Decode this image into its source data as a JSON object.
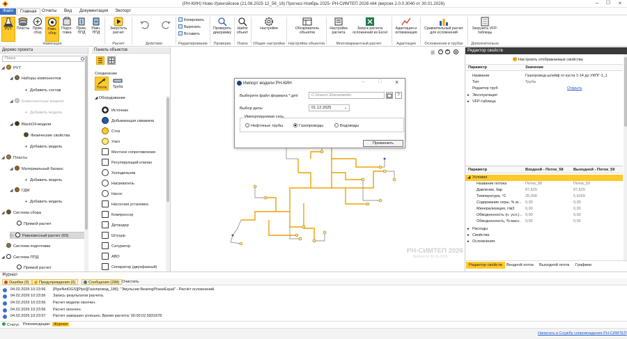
{
  "window": {
    "title": "(РН-КИН) Ново-Уренгойское (21.08.2025 12_56_16) Прогноз Ноябрь 2025-     РН-СИМТЕП 2026 x64 (версия 2.0.0.3040 от 30.01.2026)"
  },
  "menu": {
    "items": [
      "Файл",
      "Главная",
      "Отчеты",
      "Вид",
      "Документация",
      "Экспорт"
    ]
  },
  "ribbon": {
    "buttons": [
      {
        "label": "PVT"
      },
      {
        "label": "Пласты"
      },
      {
        "label": "Прям. сбор"
      },
      {
        "label": "Равн. сбор"
      },
      {
        "label": "Подго- товка"
      },
      {
        "label": "Прям. ППД"
      },
      {
        "label": "Равн. ППД"
      },
      {
        "label": "Запустить расчет"
      },
      {
        "label": "Проверить диаграмму"
      },
      {
        "label": "Найти объект"
      },
      {
        "label": "Настройки"
      },
      {
        "label": "Обозреватель объектов"
      },
      {
        "label": "Настройка расчета"
      },
      {
        "label": "Запуск расчета осложнений из Excel"
      },
      {
        "label": "Адаптация и оптимизация"
      },
      {
        "label": "Сравнительный расчет для осложнений"
      },
      {
        "label": "Загрузить VFP-таблицы"
      }
    ],
    "small": [
      "Копировать",
      "Вырезать",
      "Вставить"
    ],
    "groups": [
      "Навигация",
      "Расчет",
      "Действия",
      "Редактирование",
      "Проверка",
      "Поиск",
      "Общие настройки",
      "Настройка объектов",
      "Многовариантный расчет",
      "Адаптация",
      "Осложнения в трубах",
      "Дополнительно"
    ]
  },
  "tree": {
    "header": "Дерево проекта",
    "search_placeholder": "Поиск",
    "items": [
      {
        "label": "PVT"
      },
      {
        "label": "Наборы компонентов"
      },
      {
        "label": "Добавить состав"
      },
      {
        "label": "Компонентные модели"
      },
      {
        "label": "Добавить модель"
      },
      {
        "label": "BlackOil-модели"
      },
      {
        "label": "Физические свойства"
      },
      {
        "label": "Добавить модель"
      },
      {
        "label": "Пласты"
      },
      {
        "label": "Материальный баланс"
      },
      {
        "label": "Добавить модель"
      },
      {
        "label": "ГДМ"
      },
      {
        "label": "Добавить модель"
      },
      {
        "label": "Система сбора"
      },
      {
        "label": "Прямой расчет"
      },
      {
        "label": "Равновесный расчет (69)"
      },
      {
        "label": "Система подготовки"
      },
      {
        "label": "Система ППД"
      },
      {
        "label": "Прямой расчет"
      }
    ]
  },
  "objects": {
    "header": "Панель объектов",
    "connection_label": "Соединение",
    "connections": [
      "Поток",
      "Труба"
    ],
    "equipment_label": "Оборудование",
    "equipment": [
      "Источник",
      "Добывающая скважина",
      "Сток",
      "Узел",
      "Местное сопротивление",
      "Регулирующий клапан",
      "Холодильник",
      "Нагреватель",
      "Насос",
      "Насосная установка",
      "Компрессор",
      "Детандер",
      "Штуцер",
      "Сатуратор",
      "АВО",
      "Сепаратор (двухфазный)"
    ]
  },
  "canvas": {
    "toolbar_icons": [
      "list-view-icon",
      "zoom-out-icon",
      "zoom-in-icon",
      "zoom-fit-icon"
    ],
    "watermark_title": "РН-СИМТЕП 2026",
    "watermark_sub": "Версия от 30.01.2026"
  },
  "dialog": {
    "title": "Импорт модели РН-КИН",
    "file_label": "Выберите файл формата *.gml",
    "file_path": "C:\\Users\\             \\Documents\\",
    "date_label": "Выбор даты",
    "date_value": "01.12.2025",
    "network_label": "Импортируемая сеть",
    "networks": [
      "Нефтяные трубы",
      "Газопроводы",
      "Водоводы"
    ],
    "selected_network": "Газопроводы",
    "apply": "Применить",
    "help": "?"
  },
  "props": {
    "header": "Редактор свойств",
    "config_link": "Настроить отображаемые свойства",
    "col_param": "Параметр",
    "col_value": "Значение",
    "rows": [
      {
        "name": "Название",
        "value": "Газопровод-шлейф от куста 1-14 до УКПГ-1_1"
      },
      {
        "name": "Тип",
        "value": "Труба"
      },
      {
        "name": "Редактор труб",
        "value": "Открыть"
      },
      {
        "name": "Эксплуатация",
        "value": ""
      },
      {
        "name": "VFP-таблица",
        "value": ""
      }
    ],
    "grid_cols": [
      "Параметр",
      "Входной - Поток_58",
      "Выходной - Поток_59"
    ],
    "conditions_label": "Условия",
    "grid_rows": [
      {
        "name": "Название потока",
        "in": "Поток_58",
        "out": "Поток_59"
      },
      {
        "name": "Давление, бар",
        "in": "87,629",
        "out": "87,629"
      },
      {
        "name": "Температура, °C",
        "in": "25,000",
        "out": "5,6259"
      },
      {
        "name": "Содержание серы, % м...",
        "in": "0,00",
        "out": "0,00"
      },
      {
        "name": "Минерализация, г/м3",
        "in": "0,00",
        "out": "0,00"
      },
      {
        "name": "Обводненность (н. усл.)...",
        "in": "0,00",
        "out": "0,00"
      },
      {
        "name": "Обводненность, % масс.",
        "in": "0,00",
        "out": "0,00"
      }
    ],
    "groups": [
      "Расходы",
      "Свойства",
      "Осложнения"
    ],
    "tabs": [
      "Редактор свойств",
      "Входной поток",
      "Выходной поток",
      "Графики"
    ]
  },
  "journal": {
    "header": "Журнал",
    "filters": [
      {
        "label": "Ошибки (0)",
        "color": "#d9412b"
      },
      {
        "label": "Предупреждения (0)",
        "color": "#f0a800"
      },
      {
        "label": "Сообщения (288)",
        "color": "#3b6fc9"
      }
    ],
    "clear": "Очистить",
    "rows": [
      {
        "time": "04.02.2026 10:23:56",
        "msg": "[PipeNetOGS][Pipe][Газопровод_186]: \"Эмульсии BearingPhaseEqual\" - Расчёт осложнений."
      },
      {
        "time": "04.02.2026 10:23:56",
        "msg": "Запись результатов расчета."
      },
      {
        "time": "04.02.2026 10:23:56",
        "msg": "Расчет модели окончен."
      },
      {
        "time": "04.02.2026 10:23:56",
        "msg": "Расчет окончен."
      },
      {
        "time": "04.02.2026 10:23:57",
        "msg": "Расчет завершен успешно. Время расчета: 00:00:02.5831878"
      }
    ]
  },
  "status": {
    "tabs": [
      "Статус",
      "Рекомендации",
      "Журнал"
    ]
  },
  "footer": {
    "link": "Написать в Службу сопровождения РН-СИМТЕП"
  },
  "colors": {
    "accent": "#ffc928",
    "pipe": "#f0a000",
    "dark_header": "#3a3a3a",
    "link": "#1f5bd1"
  }
}
